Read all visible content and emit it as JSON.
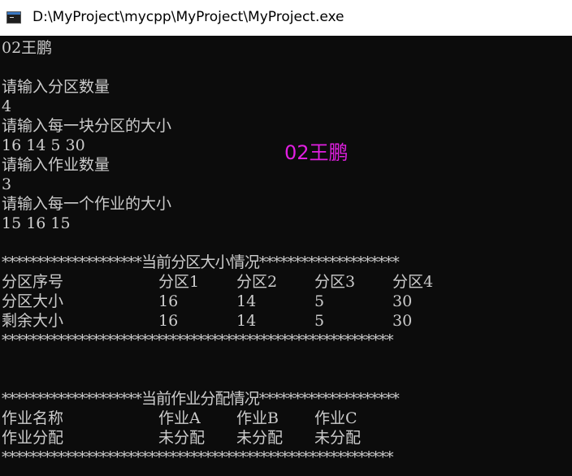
{
  "window": {
    "title": "D:\\MyProject\\mycpp\\MyProject\\MyProject.exe"
  },
  "console": {
    "line_author": "02王鹏",
    "prompt_partition_count": "请输入分区数量",
    "partition_count": "4",
    "prompt_partition_sizes": "请输入每一块分区的大小",
    "partition_sizes": "16 14 5 30",
    "prompt_job_count": "请输入作业数量",
    "job_count": "3",
    "prompt_job_sizes": "请输入每一个作业的大小",
    "job_sizes": "15 16 15",
    "partition_header": "********************当前分区大小情况********************",
    "partition_table": {
      "columns": [
        "分区序号",
        "分区1",
        "分区2",
        "分区3",
        "分区4"
      ],
      "rows": [
        [
          "分区大小",
          "16",
          "14",
          "5",
          "30"
        ],
        [
          "剩余大小",
          "16",
          "14",
          "5",
          "30"
        ]
      ]
    },
    "separator": "********************************************************",
    "job_header": "********************当前作业分配情况********************",
    "job_table": {
      "columns": [
        "作业名称",
        "作业A",
        "作业B",
        "作业C"
      ],
      "rows": [
        [
          "作业分配",
          "未分配",
          "未分配",
          "未分配"
        ]
      ]
    }
  },
  "watermark": "02王鹏"
}
